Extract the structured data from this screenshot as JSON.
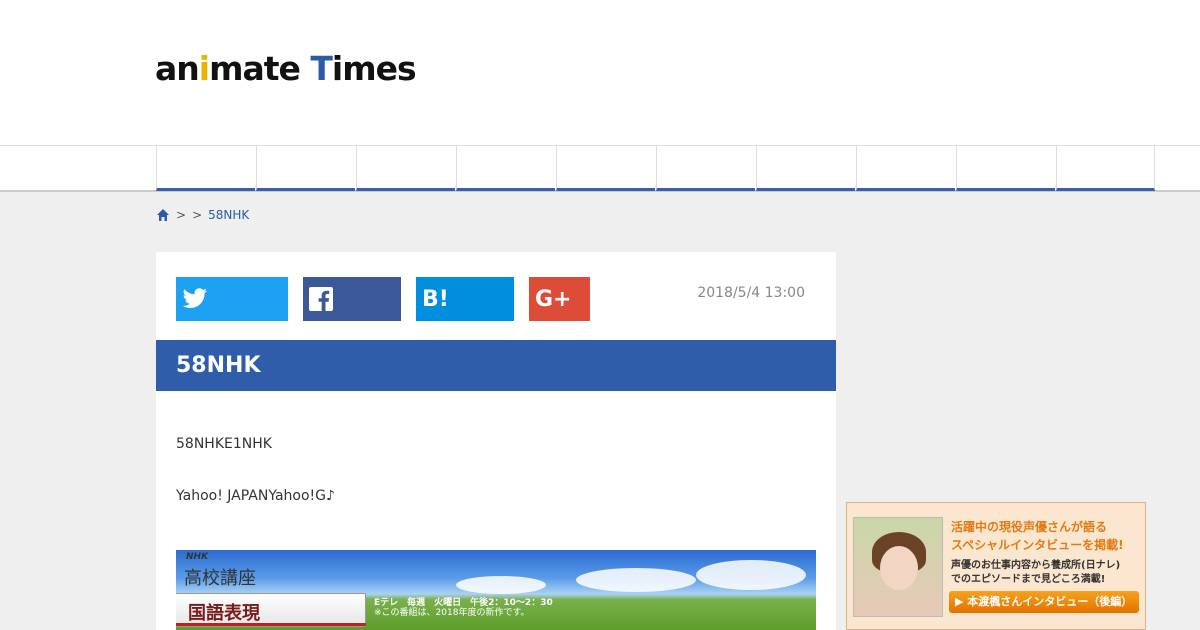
{
  "header": {
    "logo_text": "animate Times",
    "logo_prefix": "an",
    "logo_i": "i",
    "logo_mid": "mate ",
    "logo_T": "T",
    "logo_end": "imes"
  },
  "nav": {
    "item_count": 10
  },
  "breadcrumb": {
    "sep1": ">",
    "sep2": ">",
    "current": "58NHK"
  },
  "article": {
    "date": "2018/5/4 13:00",
    "title": "58NHK",
    "paragraphs": [
      "58NHKE1NHK",
      "Yahoo! JAPANYahoo!G♪"
    ],
    "share": {
      "twitter": "twitter-icon",
      "facebook": "facebook-icon",
      "hatena": "B!",
      "google": "G+"
    },
    "banner": {
      "logo_sub": "NHK",
      "logo": "高校講座",
      "subject": "国語表現",
      "schedule": "Eテレ　毎週　火曜日　午後2：10〜2：30",
      "note": "※この番組は、2018年度の新作です。"
    }
  },
  "ad": {
    "headline1": "活躍中の現役声優さんが語る",
    "headline2": "スペシャルインタビューを掲載!",
    "sub1": "声優のお仕事内容から養成所(日ナレ)",
    "sub2": "でのエピソードまで見どころ満載!",
    "button": "▶ 本渡楓さんインタビュー（後編）"
  },
  "colors": {
    "accent_blue": "#2f5daa",
    "twitter": "#1da1f2",
    "facebook": "#3b5998",
    "hatena": "#008fde",
    "google": "#dd4b39"
  }
}
